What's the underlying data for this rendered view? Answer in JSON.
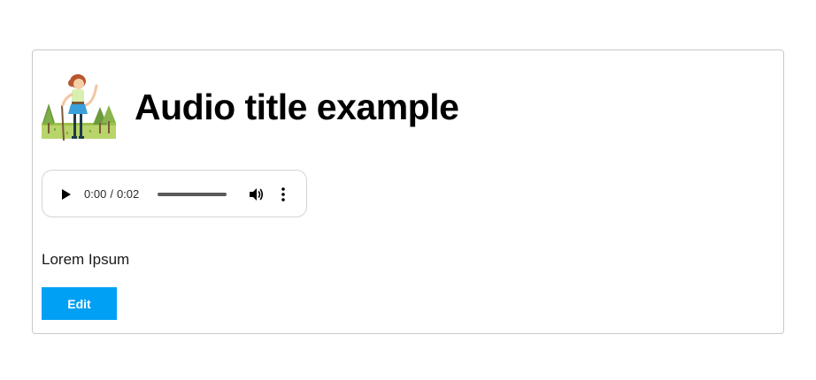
{
  "card": {
    "title": "Audio title example",
    "description": "Lorem Ipsum",
    "edit_label": "Edit",
    "thumbnail_icon": "hiker-illustration"
  },
  "player": {
    "current_time": "0:00",
    "separator": "/",
    "duration": "0:02",
    "progress": 0,
    "play_icon": "play-icon",
    "volume_icon": "volume-icon",
    "more_icon": "more-vertical-icon"
  },
  "colors": {
    "accent": "#00a0f5",
    "border": "#c9c9c9",
    "text": "#000000"
  }
}
